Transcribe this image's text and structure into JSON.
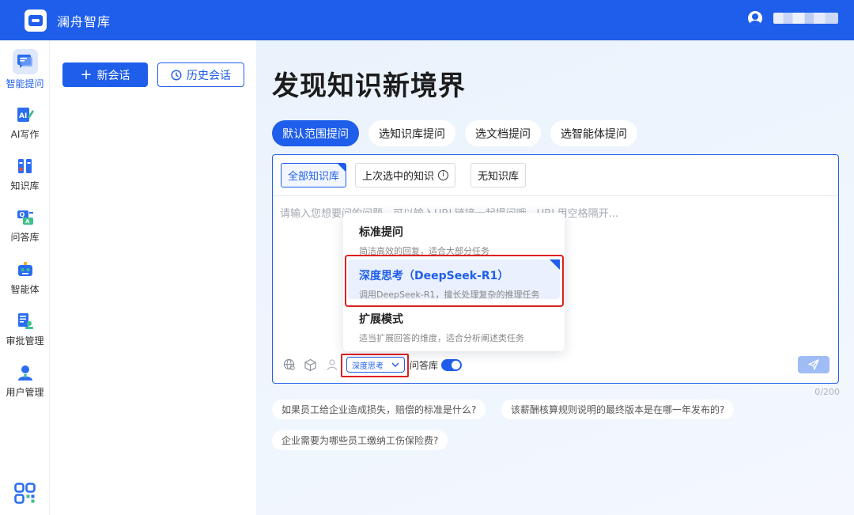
{
  "app": {
    "title": "澜舟智库"
  },
  "sidebar": {
    "items": [
      {
        "label": "智能提问",
        "icon": "chat-icon",
        "active": true
      },
      {
        "label": "AI写作",
        "icon": "ai-write-icon",
        "active": false
      },
      {
        "label": "知识库",
        "icon": "knowledge-base-icon",
        "active": false
      },
      {
        "label": "问答库",
        "icon": "qa-library-icon",
        "active": false
      },
      {
        "label": "智能体",
        "icon": "agent-robot-icon",
        "active": false
      },
      {
        "label": "审批管理",
        "icon": "approval-icon",
        "active": false
      },
      {
        "label": "用户管理",
        "icon": "user-management-icon",
        "active": false
      }
    ],
    "bottom_icon": "app-grid-icon"
  },
  "history": {
    "new_label": "新会话",
    "history_label": "历史会话"
  },
  "main": {
    "title": "发现知识新境界",
    "tabs": [
      {
        "label": "默认范围提问",
        "active": true
      },
      {
        "label": "选知识库提问",
        "active": false
      },
      {
        "label": "选文档提问",
        "active": false
      },
      {
        "label": "选智能体提问",
        "active": false
      }
    ],
    "scopes": [
      {
        "label": "全部知识库",
        "active": true
      },
      {
        "label": "上次选中的知识",
        "active": false,
        "info": "i"
      },
      {
        "label": "无知识库",
        "active": false
      }
    ],
    "input_placeholder": "请输入您想要问的问题，可以输入URL链接一起提问哦，URL用空格隔开...",
    "mode_selected": "深度思考",
    "qa_toggle_label": "问答库",
    "qa_toggle_on": true,
    "counter": "0/200",
    "suggestions": [
      "如果员工给企业造成损失，赔偿的标准是什么?",
      "该薪酬核算规则说明的最终版本是在哪一年发布的?",
      "企业需要为哪些员工缴纳工伤保险费?"
    ]
  },
  "mode_dropdown": {
    "options": [
      {
        "title": "标准提问",
        "desc": "简洁高效的回复，适合大部分任务",
        "selected": false
      },
      {
        "title": "深度思考（DeepSeek-R1）",
        "desc": "调用DeepSeek-R1，擅长处理复杂的推理任务",
        "selected": true
      },
      {
        "title": "扩展模式",
        "desc": "适当扩展回答的维度，适合分析阐述类任务",
        "selected": false
      }
    ]
  },
  "colors": {
    "primary": "#1f5eea",
    "highlight_border": "#e02020"
  }
}
